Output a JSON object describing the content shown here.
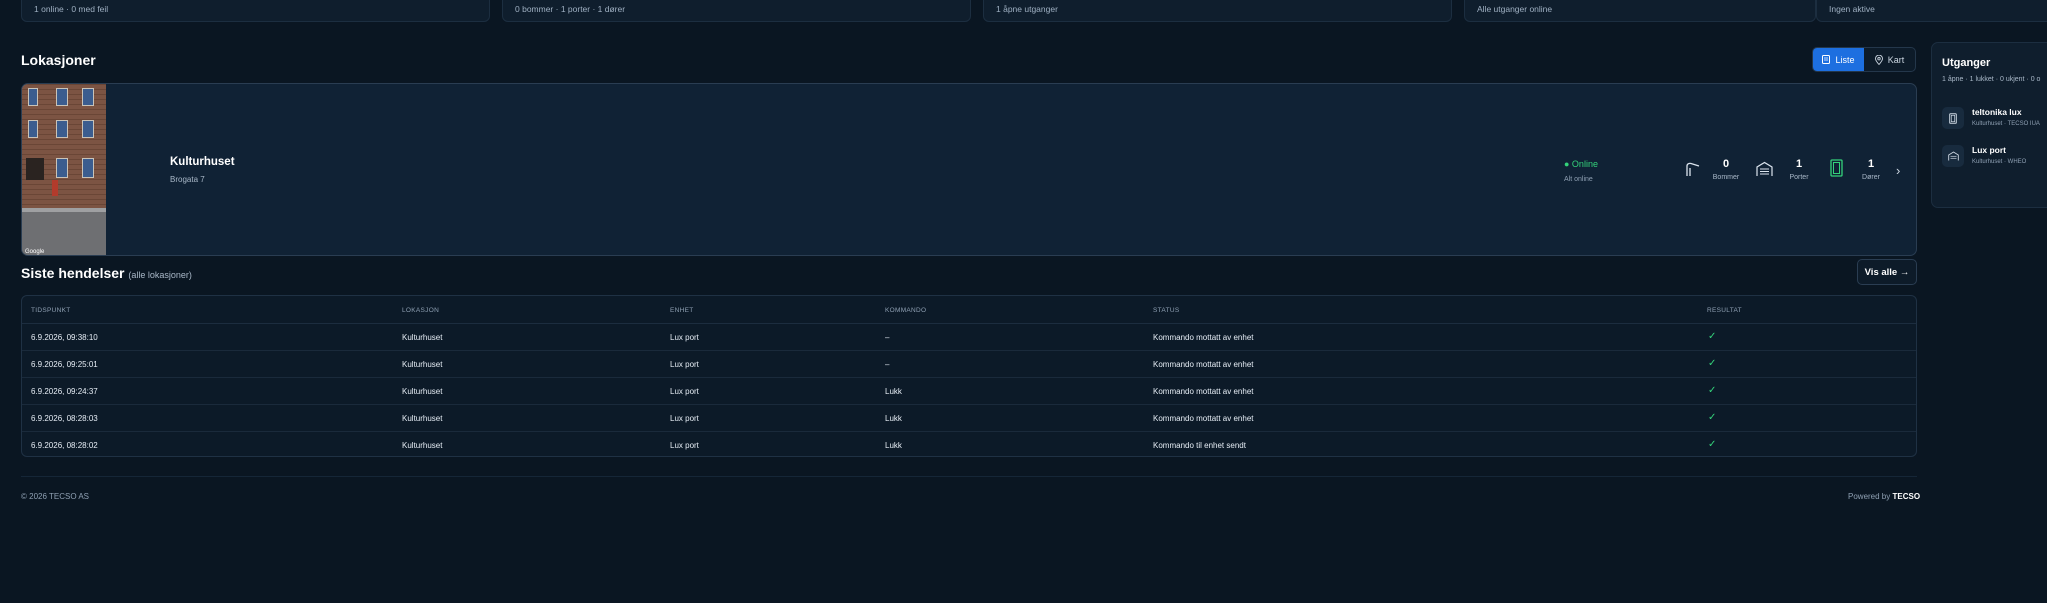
{
  "stats": [
    {
      "text": "1 online · 0 med feil"
    },
    {
      "text": "0 bommer · 1 porter · 1 dører"
    },
    {
      "text": "1 åpne utganger"
    },
    {
      "text": "Alle utganger online"
    },
    {
      "text": "Ingen aktive"
    }
  ],
  "locations": {
    "title": "Lokasjoner",
    "view_list": "Liste",
    "view_map": "Kart",
    "card": {
      "name": "Kulturhuset",
      "address": "Brogata 7",
      "photo_credit": "Google",
      "status": "● Online",
      "status_sub": "Alt online",
      "metrics": [
        {
          "value": "0",
          "label": "Bommer"
        },
        {
          "value": "1",
          "label": "Porter"
        },
        {
          "value": "1",
          "label": "Dører"
        }
      ]
    }
  },
  "events": {
    "title": "Siste hendelser",
    "subtitle": "(alle lokasjoner)",
    "view_all": "Vis alle →",
    "columns": [
      "TIDSPUNKT",
      "LOKASJON",
      "ENHET",
      "KOMMANDO",
      "STATUS",
      "RESULTAT"
    ],
    "rows": [
      {
        "time": "6.9.2026, 09:38:10",
        "location": "Kulturhuset",
        "unit": "Lux port",
        "command": "–",
        "status": "Kommando mottatt av enhet",
        "result": "✓"
      },
      {
        "time": "6.9.2026, 09:25:01",
        "location": "Kulturhuset",
        "unit": "Lux port",
        "command": "–",
        "status": "Kommando mottatt av enhet",
        "result": "✓"
      },
      {
        "time": "6.9.2026, 09:24:37",
        "location": "Kulturhuset",
        "unit": "Lux port",
        "command": "Lukk",
        "status": "Kommando mottatt av enhet",
        "result": "✓"
      },
      {
        "time": "6.9.2026, 08:28:03",
        "location": "Kulturhuset",
        "unit": "Lux port",
        "command": "Lukk",
        "status": "Kommando mottatt av enhet",
        "result": "✓"
      },
      {
        "time": "6.9.2026, 08:28:02",
        "location": "Kulturhuset",
        "unit": "Lux port",
        "command": "Lukk",
        "status": "Kommando til enhet sendt",
        "result": "✓"
      }
    ]
  },
  "footer": {
    "copyright": "© 2026 TECSO AS",
    "powered_prefix": "Powered by",
    "powered_brand": "TECSO"
  },
  "sidebar": {
    "title": "Utganger",
    "subtitle": "1 åpne · 1 lukket · 0 ukjent · 0 o",
    "items": [
      {
        "name": "teltonika lux",
        "sub": "Kulturhuset · TECSO IUA",
        "icon": "door-icon"
      },
      {
        "name": "Lux port",
        "sub": "Kulturhuset · WHEO",
        "icon": "garage-icon"
      }
    ]
  },
  "colors": {
    "background": "#0a1622",
    "accent": "#1d6fe0",
    "online": "#34d27a"
  }
}
